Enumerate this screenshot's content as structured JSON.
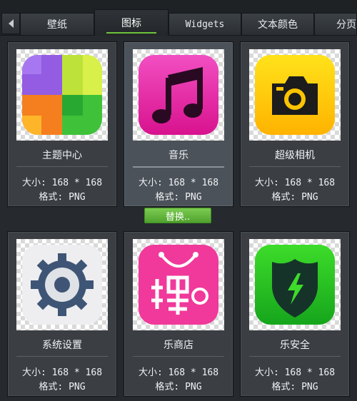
{
  "tabs": [
    {
      "label": "壁纸"
    },
    {
      "label": "图标"
    },
    {
      "label": "Widgets"
    },
    {
      "label": "文本颜色"
    },
    {
      "label": "分页"
    }
  ],
  "active_tab": "图标",
  "replace_button_label": "替换..",
  "cards": [
    {
      "name": "主题中心",
      "size": "大小: 168 * 168",
      "format": "格式: PNG",
      "icon": "theme-center-icon"
    },
    {
      "name": "音乐",
      "size": "大小: 168 * 168",
      "format": "格式: PNG",
      "icon": "music-icon"
    },
    {
      "name": "超级相机",
      "size": "大小: 168 * 168",
      "format": "格式: PNG",
      "icon": "camera-icon"
    },
    {
      "name": "系统设置",
      "size": "大小: 168 * 168",
      "format": "格式: PNG",
      "icon": "settings-gear-icon"
    },
    {
      "name": "乐商店",
      "size": "大小: 168 * 168",
      "format": "格式: PNG",
      "icon": "store-bag-icon"
    },
    {
      "name": "乐安全",
      "size": "大小: 168 * 168",
      "format": "格式: PNG",
      "icon": "security-shield-icon"
    }
  ],
  "colors": {
    "accent": "#6ec43a",
    "background": "#262a2e",
    "card": "#3b3f44"
  }
}
